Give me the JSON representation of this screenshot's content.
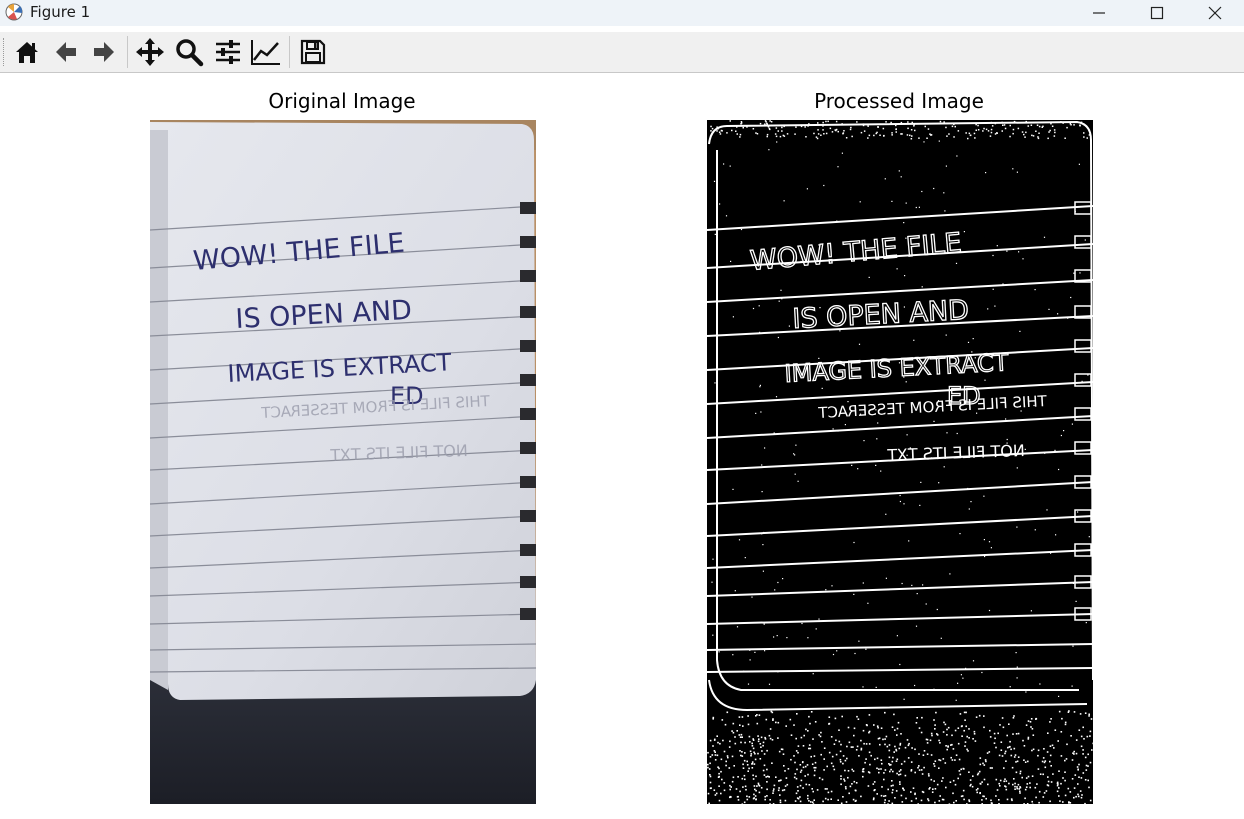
{
  "window": {
    "title": "Figure 1"
  },
  "titlebar": {
    "minimize_icon": "minimize-icon",
    "maximize_icon": "maximize-icon",
    "close_icon": "close-icon"
  },
  "toolbar": {
    "buttons": [
      {
        "name": "home",
        "icon": "home-icon"
      },
      {
        "name": "back",
        "icon": "arrow-left-icon"
      },
      {
        "name": "forward",
        "icon": "arrow-right-icon"
      },
      {
        "name": "pan",
        "icon": "move-icon"
      },
      {
        "name": "zoom",
        "icon": "magnifier-icon"
      },
      {
        "name": "configure-subplots",
        "icon": "sliders-icon"
      },
      {
        "name": "edit-axes",
        "icon": "line-chart-icon"
      },
      {
        "name": "save",
        "icon": "floppy-disk-icon"
      }
    ]
  },
  "figure": {
    "left_title": "Original Image",
    "right_title": "Processed Image"
  },
  "handwriting": {
    "line1": "WOW! THE FILE",
    "line2": "IS OPEN AND",
    "line3": "IMAGE IS EXTRACT",
    "line4": "ED",
    "mirrored1": "THIS FILE IS FROM TESSERACT",
    "mirrored2": "NOT FILE ITS TXT"
  },
  "colors": {
    "titlebar_bg": "#eef3f8",
    "toolbar_bg": "#f0f0f0",
    "ink": "#2d2f6e"
  }
}
